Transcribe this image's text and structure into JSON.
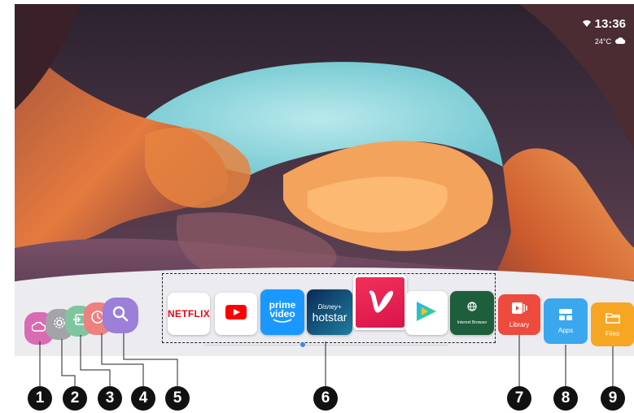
{
  "status": {
    "time": "13:36",
    "temperature": "24°C",
    "wifi_icon": "wifi-icon",
    "weather_icon": "cloud-icon"
  },
  "quick_controls": [
    {
      "name": "input-source",
      "icon": "cloud-icon",
      "color": "#d96bb3"
    },
    {
      "name": "settings",
      "icon": "gear-icon",
      "color": "#9a9a9e"
    },
    {
      "name": "input",
      "icon": "input-icon",
      "color": "#7fc6a0"
    },
    {
      "name": "timer",
      "icon": "clock-icon",
      "color": "#ee7f7f"
    },
    {
      "name": "search",
      "icon": "search-icon",
      "color": "#9b7fd8"
    }
  ],
  "apps": {
    "netflix": "NETFLIX",
    "youtube_icon": "youtube-icon",
    "prime_line1": "prime",
    "prime_line2": "video",
    "disney": "Disney+",
    "hotstar": "hotstar",
    "vidaa_icon": "v-logo-icon",
    "play_icon": "play-icon",
    "browser": "Internet Browser"
  },
  "shortcuts": {
    "library": "Library",
    "apps": "Apps",
    "files": "Files"
  },
  "callouts": [
    "1",
    "2",
    "3",
    "4",
    "5",
    "6",
    "7",
    "8",
    "9"
  ]
}
